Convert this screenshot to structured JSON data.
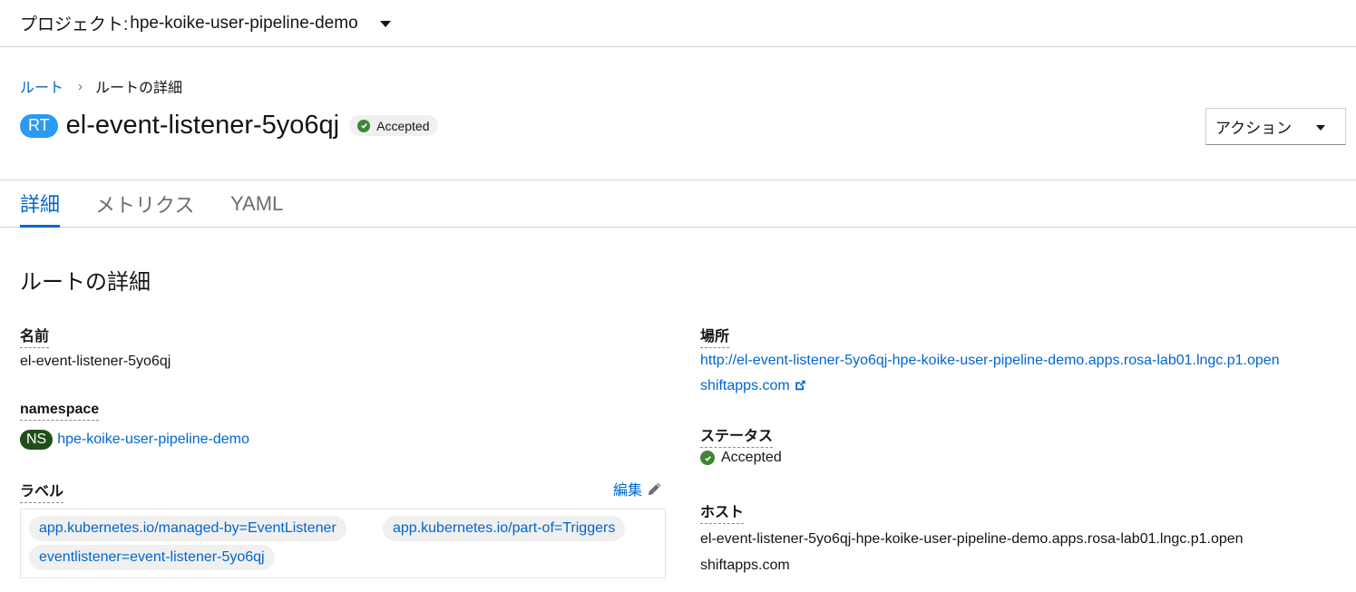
{
  "project": {
    "label": "プロジェクト:",
    "name": "hpe-koike-user-pipeline-demo"
  },
  "breadcrumb": {
    "parent": "ルート",
    "current": "ルートの詳細"
  },
  "header": {
    "kind_badge": "RT",
    "title": "el-event-listener-5yo6qj",
    "status": "Accepted",
    "actions_label": "アクション"
  },
  "tabs": [
    {
      "label": "詳細",
      "active": true
    },
    {
      "label": "メトリクス",
      "active": false
    },
    {
      "label": "YAML",
      "active": false
    }
  ],
  "section_title": "ルートの詳細",
  "details": {
    "name_label": "名前",
    "name_value": "el-event-listener-5yo6qj",
    "namespace_label": "namespace",
    "namespace_badge": "NS",
    "namespace_value": "hpe-koike-user-pipeline-demo",
    "labels_label": "ラベル",
    "edit_label": "編集",
    "labels": [
      "app.kubernetes.io/managed-by=EventListener",
      "app.kubernetes.io/part-of=Triggers",
      "eventlistener=event-listener-5yo6qj"
    ],
    "location_label": "場所",
    "location_value": "http://el-event-listener-5yo6qj-hpe-koike-user-pipeline-demo.apps.rosa-lab01.lngc.p1.openshiftapps.com",
    "status_label": "ステータス",
    "status_value": "Accepted",
    "host_label": "ホスト",
    "host_value": "el-event-listener-5yo6qj-hpe-koike-user-pipeline-demo.apps.rosa-lab01.lngc.p1.openshiftapps.com"
  },
  "colors": {
    "link": "#0066cc",
    "success": "#3e8635",
    "rt_badge": "#2b9af3",
    "ns_badge": "#1e4f18"
  },
  "icons": {
    "status": "check-circle-icon",
    "external": "external-link-icon",
    "edit": "pencil-icon",
    "dropdown": "caret-down-icon"
  }
}
